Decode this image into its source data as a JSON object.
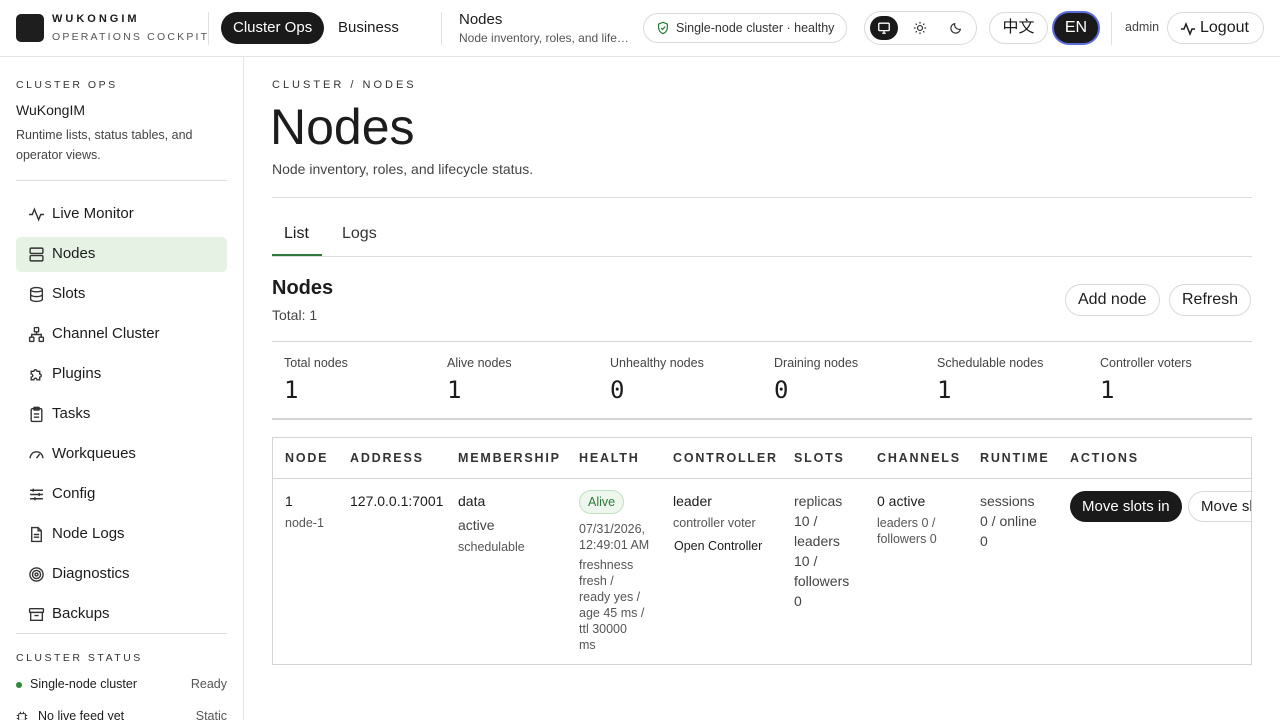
{
  "brand": {
    "name": "WUKONGIM",
    "subtitle": "OPERATIONS COCKPIT"
  },
  "topnav": {
    "cluster_ops": "Cluster Ops",
    "business": "Business"
  },
  "header": {
    "title": "Nodes",
    "subtitle": "Node inventory, roles, and lifecycle status."
  },
  "status_chip": "Single-node cluster · healthy",
  "theme": {
    "options": [
      "monitor-icon",
      "sun-icon",
      "moon-icon"
    ],
    "active": "monitor-icon"
  },
  "lang": {
    "zh": "中文",
    "en": "EN",
    "active": "EN"
  },
  "user": {
    "name": "admin",
    "logout": "Logout"
  },
  "sidebar": {
    "kicker": "CLUSTER OPS",
    "app": "WuKongIM",
    "description": "Runtime lists, status tables, and operator views.",
    "items": [
      {
        "label": "Live Monitor",
        "icon": "activity-icon"
      },
      {
        "label": "Nodes",
        "icon": "server-icon",
        "active": true
      },
      {
        "label": "Slots",
        "icon": "database-icon"
      },
      {
        "label": "Channel Cluster",
        "icon": "network-icon"
      },
      {
        "label": "Plugins",
        "icon": "puzzle-icon"
      },
      {
        "label": "Tasks",
        "icon": "clipboard-icon"
      },
      {
        "label": "Workqueues",
        "icon": "gauge-icon"
      },
      {
        "label": "Config",
        "icon": "sliders-icon"
      },
      {
        "label": "Node Logs",
        "icon": "file-text-icon"
      },
      {
        "label": "Diagnostics",
        "icon": "target-icon"
      },
      {
        "label": "Backups",
        "icon": "archive-icon"
      }
    ],
    "status_kicker": "CLUSTER STATUS",
    "status_rows": [
      {
        "label": "Single-node cluster",
        "value": "Ready"
      },
      {
        "label": "No live feed yet",
        "value": "Static"
      }
    ]
  },
  "main": {
    "breadcrumb": "CLUSTER / NODES",
    "title": "Nodes",
    "description": "Node inventory, roles, and lifecycle status.",
    "tabs": [
      {
        "label": "List",
        "active": true
      },
      {
        "label": "Logs"
      }
    ],
    "section_title": "Nodes",
    "total": "Total: 1",
    "buttons": {
      "add_node": "Add node",
      "refresh": "Refresh"
    },
    "stats": [
      {
        "label": "Total nodes",
        "value": "1"
      },
      {
        "label": "Alive nodes",
        "value": "1"
      },
      {
        "label": "Unhealthy nodes",
        "value": "0"
      },
      {
        "label": "Draining nodes",
        "value": "0"
      },
      {
        "label": "Schedulable nodes",
        "value": "1"
      },
      {
        "label": "Controller voters",
        "value": "1"
      }
    ],
    "table": {
      "columns": [
        "NODE",
        "ADDRESS",
        "MEMBERSHIP",
        "HEALTH",
        "CONTROLLER",
        "SLOTS",
        "CHANNELS",
        "RUNTIME",
        "ACTIONS"
      ],
      "rows": [
        {
          "node_id": "1",
          "node_name": "node-1",
          "address": "127.0.0.1:7001",
          "membership_role": "data",
          "membership_state": "active",
          "membership_sched": "schedulable",
          "health_badge": "Alive",
          "health_time_1": "07/31/2026,",
          "health_time_2": "12:49:01 AM",
          "health_detail": [
            "freshness",
            "fresh /",
            "ready yes /",
            "age 45 ms /",
            "ttl 30000",
            "ms"
          ],
          "controller_role": "leader",
          "controller_voter": "controller voter",
          "controller_link": "Open Controller",
          "slots": [
            "replicas",
            "10 /",
            "leaders",
            "10 /",
            "followers",
            "0"
          ],
          "channels_active": "0 active",
          "channels_detail": [
            "leaders 0 /",
            "followers 0"
          ],
          "runtime": [
            "sessions",
            "0 / online",
            "0"
          ],
          "actions": {
            "primary": "Move slots in",
            "secondary": "Move slots out"
          }
        }
      ]
    }
  }
}
